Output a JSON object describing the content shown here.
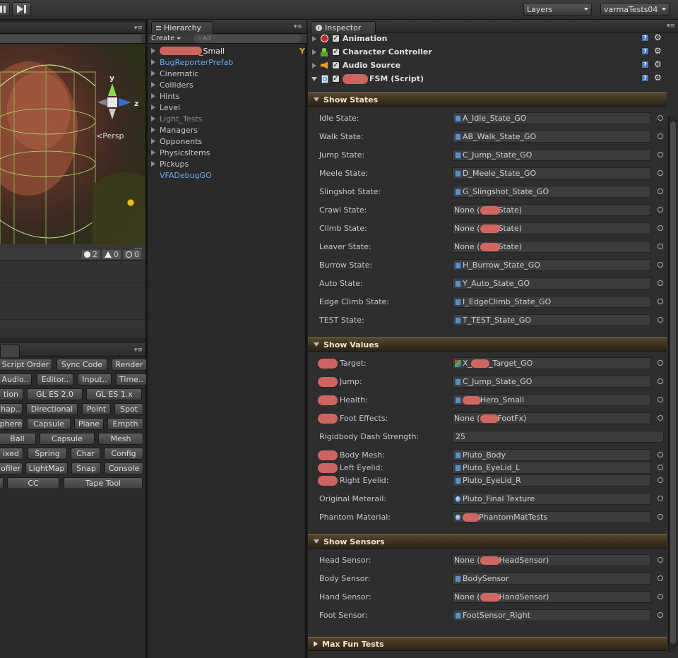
{
  "toolbar": {
    "layers_label": "Layers",
    "layout_label": "varmaTests04"
  },
  "scene": {
    "gizmo": {
      "y": "y",
      "z": "z",
      "persp": "Persp"
    },
    "console_counts": {
      "errors": "2",
      "warnings": "0",
      "info": "0"
    },
    "buttons": [
      [
        "Script Order",
        "Sync Code",
        "Render"
      ],
      [
        "Audio..",
        "Editor..",
        "Input..",
        "Time.."
      ],
      [
        "tion",
        "GL ES 2.0",
        "GL ES 1.x"
      ],
      [
        "hap..",
        "Directional",
        "Point",
        "Spot"
      ],
      [
        "phere",
        "Capsule",
        "Plane",
        "Empth"
      ],
      [
        "Ball",
        "Capsule",
        "Mesh"
      ],
      [
        "ixed",
        "Spring",
        "Char",
        "Config"
      ],
      [
        "ofiler",
        "LightMap",
        "Snap",
        "Console"
      ],
      [
        "CC",
        "Tape Tool"
      ]
    ]
  },
  "hierarchy": {
    "tab_label": "Hierarchy",
    "create_label": "Create",
    "search_placeholder": "All",
    "items": [
      {
        "label": "_Small"
      },
      {
        "label": "BugReporterPrefab"
      },
      {
        "label": "Cinematic"
      },
      {
        "label": "Colliders"
      },
      {
        "label": "Hints"
      },
      {
        "label": "Level"
      },
      {
        "label": "Light_Tests"
      },
      {
        "label": "Managers"
      },
      {
        "label": "Opponents"
      },
      {
        "label": "PhysicsItems"
      },
      {
        "label": "Pickups"
      },
      {
        "label": "VFADebugGO"
      }
    ]
  },
  "inspector": {
    "tab_label": "Inspector",
    "components": [
      {
        "label": "Animation"
      },
      {
        "label": "Character Controller"
      },
      {
        "label": "Audio Source"
      },
      {
        "label": "FSM (Script)"
      }
    ],
    "sections": {
      "states": "Show States",
      "values": "Show Values",
      "sensors": "Show Sensors",
      "maxfun": "Max Fun Tests"
    },
    "states": [
      {
        "label": "Idle State:",
        "value": "A_Idle_State_GO"
      },
      {
        "label": "Walk State:",
        "value": "AB_Walk_State_GO"
      },
      {
        "label": "Jump State:",
        "value": "C_Jump_State_GO"
      },
      {
        "label": "Meele State:",
        "value": "D_Meele_State_GO"
      },
      {
        "label": "Slingshot State:",
        "value": "G_Slingshot_State_GO"
      },
      {
        "label": "Crawl State:",
        "value": "None (",
        "suffix": "State)"
      },
      {
        "label": "Climb State:",
        "value": "None (",
        "suffix": "State)"
      },
      {
        "label": "Leaver State:",
        "value": "None (",
        "suffix": "State)"
      },
      {
        "label": "Burrow State:",
        "value": "H_Burrow_State_GO"
      },
      {
        "label": "Auto State:",
        "value": "Y_Auto_State_GO"
      },
      {
        "label": "Edge Climb State:",
        "value": "I_EdgeClimb_State_GO"
      },
      {
        "label": "TEST State:",
        "value": "T_TEST_State_GO"
      }
    ],
    "values": [
      {
        "label": "Target:",
        "value": "X_",
        "suffix": "_Target_GO"
      },
      {
        "label": "Jump:",
        "value": "C_Jump_State_GO"
      },
      {
        "label": "Health:",
        "value": "",
        "suffix": "Hero_Small"
      },
      {
        "label": "Foot Effects:",
        "value": "None (",
        "suffix": "FootFx)"
      },
      {
        "label": "Rigidbody Dash Strength:",
        "value": "25"
      },
      {
        "label": "Body Mesh:",
        "value": "Pluto_Body"
      },
      {
        "label": "Left Eyelid:",
        "value": "Pluto_EyeLid_L"
      },
      {
        "label": "Right Eyelid:",
        "value": "Pluto_EyeLid_R"
      },
      {
        "label": "Original Meterail:",
        "value": "Pluto_Final Texture"
      },
      {
        "label": "Phantom Material:",
        "value": "",
        "suffix": "PhantomMatTests"
      }
    ],
    "sensors": [
      {
        "label": "Head Sensor:",
        "value": "None (",
        "suffix": "HeadSensor)"
      },
      {
        "label": "Body Sensor:",
        "value": "BodySensor"
      },
      {
        "label": "Hand Sensor:",
        "value": "None (",
        "suffix": "HandSensor)"
      },
      {
        "label": "Foot Sensor:",
        "value": "FootSensor_Right"
      }
    ]
  }
}
